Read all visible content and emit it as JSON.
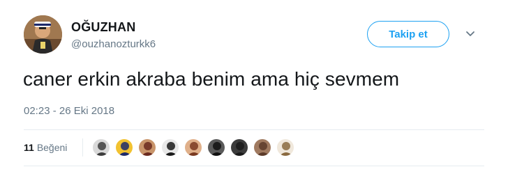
{
  "user": {
    "display_name": "OĞUZHAN",
    "handle": "@ouzhanozturkk6",
    "avatar": "profile-photo"
  },
  "follow_button": {
    "label": "Takip et"
  },
  "menu": {
    "icon": "chevron-down-icon"
  },
  "tweet": {
    "text": "caner erkin akraba benim ama hiç sevmem",
    "timestamp": "02:23 - 26 Eki 2018"
  },
  "likes": {
    "count": "11",
    "label": "Beğeni",
    "likers": [
      {
        "icon": "liker-avatar-1",
        "color": "#3d3d3d",
        "bg": "#d9d9d9"
      },
      {
        "icon": "liker-avatar-2",
        "color": "#1d2a6b",
        "bg": "#f2c230"
      },
      {
        "icon": "liker-avatar-3",
        "color": "#6b2a1f",
        "bg": "#c9956b"
      },
      {
        "icon": "liker-avatar-4",
        "color": "#1a1a1a",
        "bg": "#e8e8e8"
      },
      {
        "icon": "liker-avatar-5",
        "color": "#7a3a20",
        "bg": "#e0b08a"
      },
      {
        "icon": "liker-avatar-6",
        "color": "#101010",
        "bg": "#5a5a5a"
      },
      {
        "icon": "liker-avatar-7",
        "color": "#1a1a1a",
        "bg": "#3c3c3c"
      },
      {
        "icon": "liker-avatar-8",
        "color": "#5c3b2a",
        "bg": "#a07a60"
      },
      {
        "icon": "liker-avatar-9",
        "color": "#8a6a40",
        "bg": "#f0e8dc"
      }
    ]
  },
  "colors": {
    "accent": "#1da1f2",
    "text_primary": "#14171a",
    "text_secondary": "#657786",
    "divider": "#e6ecf0"
  }
}
